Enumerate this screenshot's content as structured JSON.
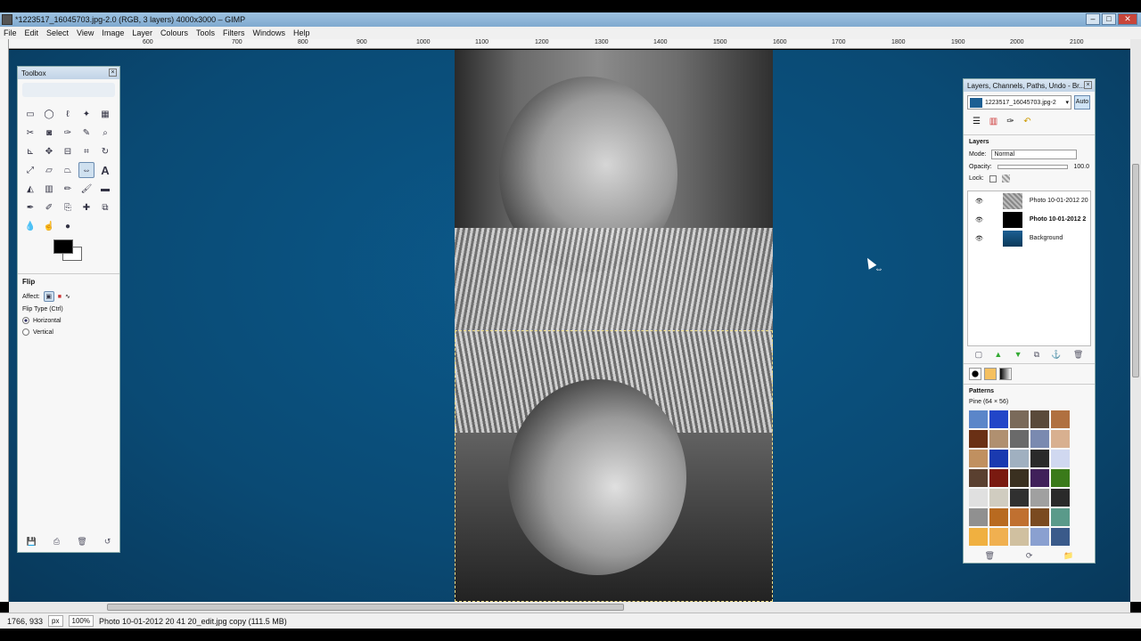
{
  "window": {
    "title": "*1223517_16045703.jpg-2.0 (RGB, 3 layers) 4000x3000 – GIMP",
    "minimize_icon": "minimize-icon",
    "maximize_icon": "maximize-icon",
    "close_icon": "close-icon"
  },
  "menu": [
    "File",
    "Edit",
    "Select",
    "View",
    "Image",
    "Layer",
    "Colours",
    "Tools",
    "Filters",
    "Windows",
    "Help"
  ],
  "ruler": {
    "top_ticks": [
      "600",
      "700",
      "800",
      "900",
      "1000",
      "1100",
      "1200",
      "1300",
      "1400",
      "1500",
      "1600",
      "1700",
      "1800",
      "1900",
      "2000",
      "2100"
    ]
  },
  "status": {
    "coords": "1766, 933",
    "unit": "px",
    "zoom": "100%",
    "message": "Photo 10-01-2012 20 41 20_edit.jpg copy (111.5 MB)"
  },
  "toolbox": {
    "title": "Toolbox",
    "tool_options_title": "Flip",
    "affect_label": "Affect:",
    "flip_type_label": "Flip Type  (Ctrl)",
    "flip_options": [
      "Horizontal",
      "Vertical"
    ],
    "selected_flip": "Horizontal",
    "tools": [
      "rect-select-icon",
      "ellipse-select-icon",
      "free-select-icon",
      "fuzzy-select-icon",
      "by-color-select-icon",
      "scissors-icon",
      "foreground-select-icon",
      "paths-icon",
      "color-picker-icon",
      "zoom-icon",
      "measure-icon",
      "move-icon",
      "align-icon",
      "crop-icon",
      "rotate-icon",
      "scale-icon",
      "shear-icon",
      "perspective-icon",
      "flip-icon",
      "text-icon",
      "bucket-fill-icon",
      "blend-icon",
      "pencil-icon",
      "paintbrush-icon",
      "eraser-icon",
      "airbrush-icon",
      "ink-icon",
      "clone-icon",
      "heal-icon",
      "perspective-clone-icon",
      "blur-icon",
      "smudge-icon",
      "dodge-burn-icon"
    ]
  },
  "dock": {
    "title": "Layers, Channels, Paths, Undo - Br...",
    "image_name": "1223517_16045703.jpg-2",
    "auto_label": "Auto",
    "layers_header": "Layers",
    "mode_label": "Mode:",
    "mode_value": "Normal",
    "opacity_label": "Opacity:",
    "opacity_value": "100.0",
    "lock_label": "Lock:",
    "layers": [
      {
        "name": "Photo 10-01-2012 20",
        "bold": false,
        "color": "#6a6a6a"
      },
      {
        "name": "Photo 10-01-2012 2",
        "bold": true,
        "color": "#000000"
      },
      {
        "name": "Background",
        "bold": false,
        "color": "#1d5f93"
      }
    ],
    "patterns_header": "Patterns",
    "pattern_info": "Pine (64 × 56)",
    "pattern_colors": [
      "#5b86c9",
      "#2246c8",
      "#7a6a5a",
      "#5a4a3a",
      "#b07040",
      "#6a3015",
      "#b09070",
      "#6a6a6a",
      "#7a8ab0",
      "#d8b090",
      "#c09060",
      "#1a3ab0",
      "#a0b0c0",
      "#2a2a2a",
      "#d0d8f0",
      "#5a4030",
      "#7a1a10",
      "#3a3020",
      "#40205a",
      "#3a7a1a",
      "#e0e0e0",
      "#d0ccc0",
      "#303030",
      "#a0a0a0",
      "#2a2a2a",
      "#909090",
      "#b86a20",
      "#c07030",
      "#7a4a20",
      "#5a9a8a",
      "#f0b040",
      "#f0b050",
      "#d0c0a0",
      "#8aa0d0",
      "#3a5a8a"
    ]
  },
  "colors": {
    "canvas_bg": "#0a4a74",
    "accent": "#6a8bb0"
  }
}
